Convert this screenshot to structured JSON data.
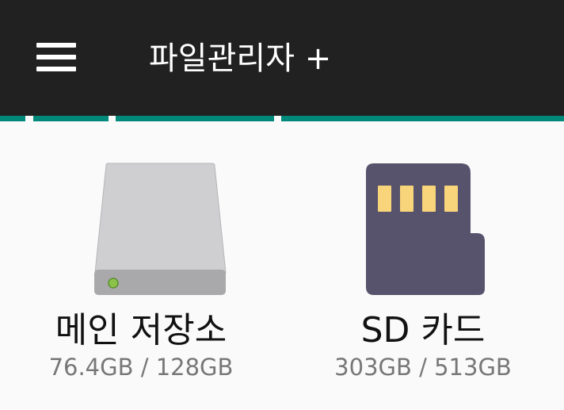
{
  "appbar": {
    "title": "파일관리자 +",
    "background": "#212121",
    "accent": "#00897b"
  },
  "storage": [
    {
      "icon": "hard-drive-icon",
      "name": "메인 저장소",
      "size": "76.4GB / 128GB"
    },
    {
      "icon": "sd-card-icon",
      "name": "SD 카드",
      "size": "303GB / 513GB"
    }
  ]
}
